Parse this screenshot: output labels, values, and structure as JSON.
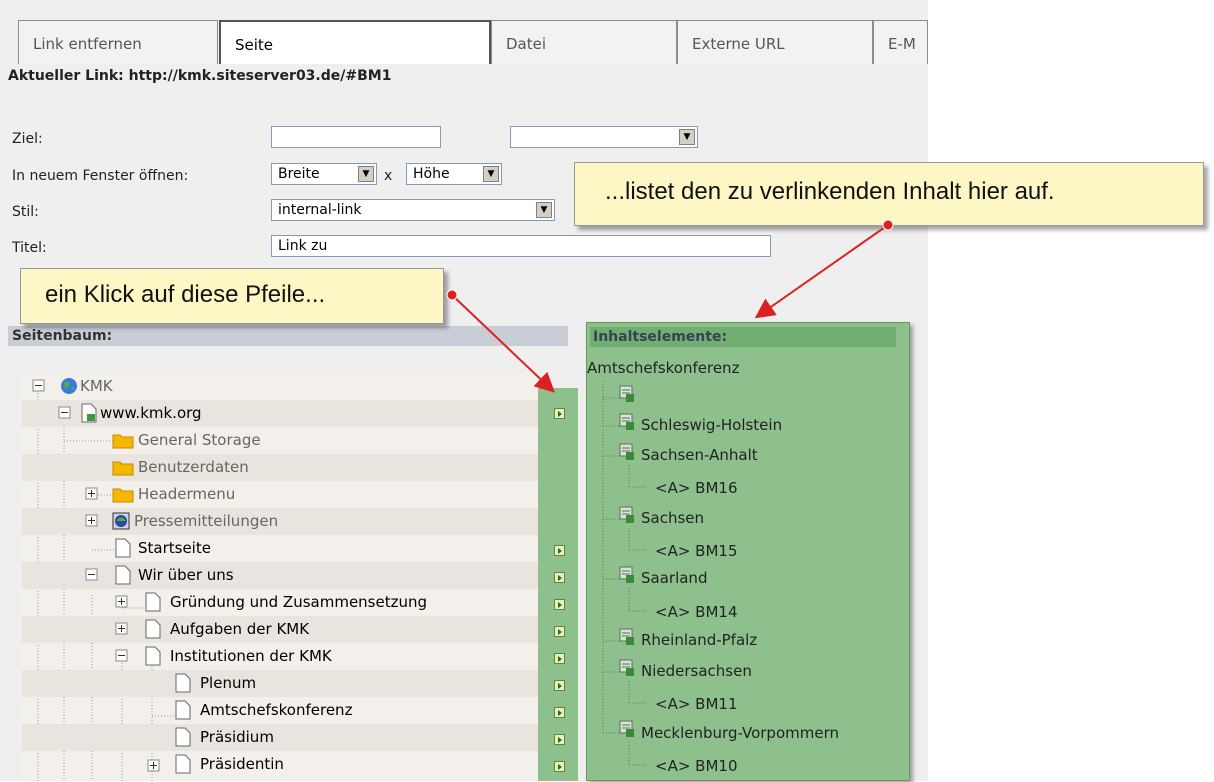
{
  "tabs": [
    "Link entfernen",
    "Seite",
    "Datei",
    "Externe URL",
    "E-M"
  ],
  "current_link": "Aktueller Link: http://kmk.siteserver03.de/#BM1",
  "form": {
    "ziel_label": "Ziel:",
    "fenster_label": "In neuem Fenster öffnen:",
    "breite": "Breite",
    "x": "x",
    "hoehe": "Höhe",
    "stil_label": "Stil:",
    "stil_value": "internal-link",
    "titel_label": "Titel:",
    "titel_value": "Link zu"
  },
  "callouts": {
    "left": "ein Klick auf diese Pfeile...",
    "right": "...listet den zu verlinkenden Inhalt hier auf."
  },
  "seitenbaum_label": "Seitenbaum:",
  "tree": [
    {
      "label": "KMK",
      "icon": "globe-icon"
    },
    {
      "label": "www.kmk.org",
      "icon": "page-icon"
    },
    {
      "label": "General Storage",
      "icon": "folder-icon"
    },
    {
      "label": "Benutzerdaten",
      "icon": "folder-icon"
    },
    {
      "label": "Headermenu",
      "icon": "folder-icon"
    },
    {
      "label": "Pressemitteilungen",
      "icon": "news-icon"
    },
    {
      "label": "Startseite",
      "icon": "page-icon"
    },
    {
      "label": "Wir über uns",
      "icon": "page-icon"
    },
    {
      "label": "Gründung und Zusammensetzung",
      "icon": "page-icon"
    },
    {
      "label": "Aufgaben der KMK",
      "icon": "page-icon"
    },
    {
      "label": "Institutionen der KMK",
      "icon": "page-icon"
    },
    {
      "label": "Plenum",
      "icon": "page-icon"
    },
    {
      "label": "Amtschefskonferenz",
      "icon": "page-icon"
    },
    {
      "label": "Präsidium",
      "icon": "page-icon"
    },
    {
      "label": "Präsidentin",
      "icon": "page-icon"
    }
  ],
  "inhaltselemente_label": "Inhaltselemente:",
  "content_root": "Amtschefskonferenz",
  "content_items": [
    {
      "label": ""
    },
    {
      "label": "Schleswig-Holstein"
    },
    {
      "label": "Sachsen-Anhalt"
    },
    {
      "label": "<A> BM16"
    },
    {
      "label": "Sachsen"
    },
    {
      "label": "<A> BM15"
    },
    {
      "label": "Saarland"
    },
    {
      "label": "<A> BM14"
    },
    {
      "label": "Rheinland-Pfalz"
    },
    {
      "label": "Niedersachsen"
    },
    {
      "label": "<A> BM11"
    },
    {
      "label": "Mecklenburg-Vorpommern"
    },
    {
      "label": "<A> BM10"
    }
  ],
  "colors": {
    "green_panel": "#8dc08d",
    "callout_bg": "#fdf7c6",
    "arrow_red": "#dd2020"
  }
}
